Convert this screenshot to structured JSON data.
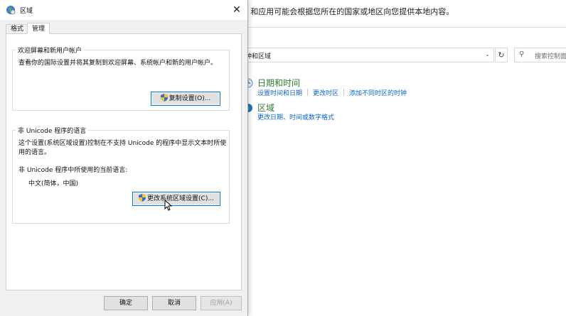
{
  "background_window": {
    "top_text": "s 和应用可能会根据您所在的国家或地区向您提供本地内容。",
    "address_text": "钟和区域",
    "search_placeholder": "搜索控制面",
    "categories": [
      {
        "title": "日期和时间",
        "links": [
          "设置时间和日期",
          "更改时区",
          "添加不同时区的时钟"
        ]
      },
      {
        "title": "区域",
        "links": [
          "更改日期、时间或数字格式"
        ]
      }
    ]
  },
  "dialog": {
    "title": "区域",
    "tabs": [
      "格式",
      "管理"
    ],
    "active_tab": "管理",
    "welcome_group": {
      "label": "欢迎屏幕和新用户帐户",
      "description": "查看你的国际设置并将其复制到欢迎屏幕、系统帐户和新的用户帐户。",
      "copy_button": "复制设置(O)..."
    },
    "unicode_group": {
      "label": "非 Unicode 程序的语言",
      "description_line1": "这个设置(系统区域设置)控制在不支持 Unicode 的程序中显示文本时所使",
      "description_line2": "用的语言。",
      "current_label": "非 Unicode 程序中所使用的当前语言:",
      "current_value": "中文(简体，中国)",
      "change_button": "更改系统区域设置(C)..."
    },
    "footer": {
      "ok": "确定",
      "cancel": "取消",
      "apply": "应用(A)"
    }
  },
  "colors": {
    "link": "#0b63c7",
    "category_title": "#2e7d32",
    "focus_border": "#0078d7"
  }
}
